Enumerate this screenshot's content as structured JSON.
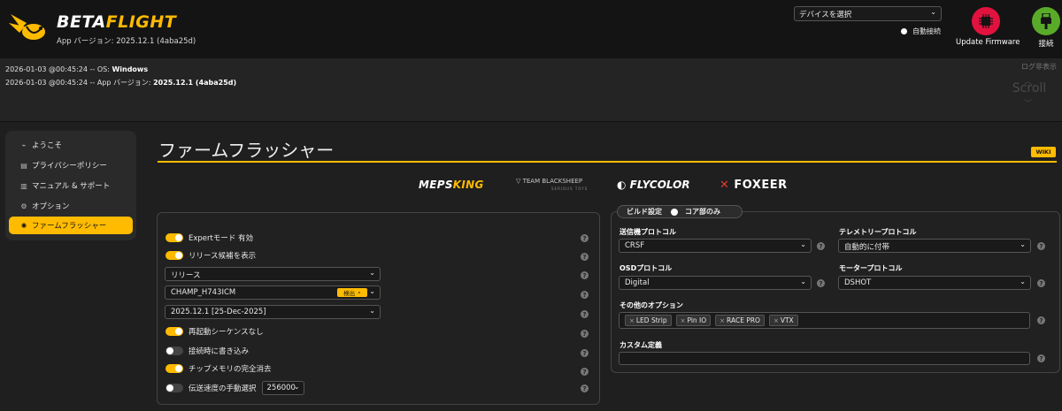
{
  "header": {
    "logo_prefix": "BETA",
    "logo_suffix": "FLIGHT",
    "app_version": "App バージョン: 2025.12.1 (4aba25d)",
    "port_select": "デバイスを選択",
    "auto_connect": "自動接続",
    "update_firmware": "Update Firmware",
    "connect": "接続",
    "icons": {
      "update_firmware": "chip-icon",
      "connect": "usb-plug-icon"
    },
    "colors": {
      "accent": "#ffbb00",
      "update_firmware": "#e2123f",
      "connect": "#59aa29"
    }
  },
  "log": {
    "lines": [
      {
        "prefix": "2026-01-03 @00:45:24 -- OS: ",
        "value": "Windows"
      },
      {
        "prefix": "2026-01-03 @00:45:24 -- App バージョン: ",
        "value": "2025.12.1 (4aba25d)"
      }
    ],
    "hide_label": "ログ非表示",
    "scroll_label": "Scroll"
  },
  "sidebar": {
    "items": [
      {
        "label": "ようこそ",
        "icon": "plug-icon"
      },
      {
        "label": "プライバシーポリシー",
        "icon": "document-icon"
      },
      {
        "label": "マニュアル & サポート",
        "icon": "book-icon"
      },
      {
        "label": "オプション",
        "icon": "gear-icon"
      },
      {
        "label": "ファームフラッシャー",
        "icon": "flash-icon",
        "active": true
      }
    ]
  },
  "main": {
    "title": "ファームフラッシャー",
    "wiki": "WIKI",
    "brands": {
      "meps_a": "MEPS",
      "meps_b": "KING",
      "blacksheep": "TEAM BLACKSHEEP",
      "blacksheep_sub": "SERIOUS TOYS",
      "flycolor": "FLYCOLOR",
      "foxeer": "FOXEER"
    },
    "left": {
      "expert": "Expertモード 有効",
      "show_rc": "リリース候補を表示",
      "release_type": "リリース",
      "board": "CHAMP_H743ICM",
      "detect": "検出",
      "version": "2025.12.1 [25-Dec-2025]",
      "no_reboot": "再起動シーケンスなし",
      "flash_on_connect": "接続時に書き込み",
      "full_chip_erase": "チップメモリの完全消去",
      "manual_baud": "伝送速度の手動選択",
      "baud_value": "256000"
    },
    "right": {
      "build_config": "ビルド設定",
      "core_only": "コア部のみ",
      "radio_protocol_label": "送信機プロトコル",
      "radio_protocol": "CRSF",
      "telemetry_label": "テレメトリープロトコル",
      "telemetry": "自動的に付帯",
      "osd_label": "OSDプロトコル",
      "osd": "Digital",
      "motor_label": "モータープロトコル",
      "motor": "DSHOT",
      "other_label": "その他のオプション",
      "options": [
        "LED Strip",
        "Pin IO",
        "RACE PRO",
        "VTX"
      ],
      "custom_label": "カスタム定義"
    }
  }
}
